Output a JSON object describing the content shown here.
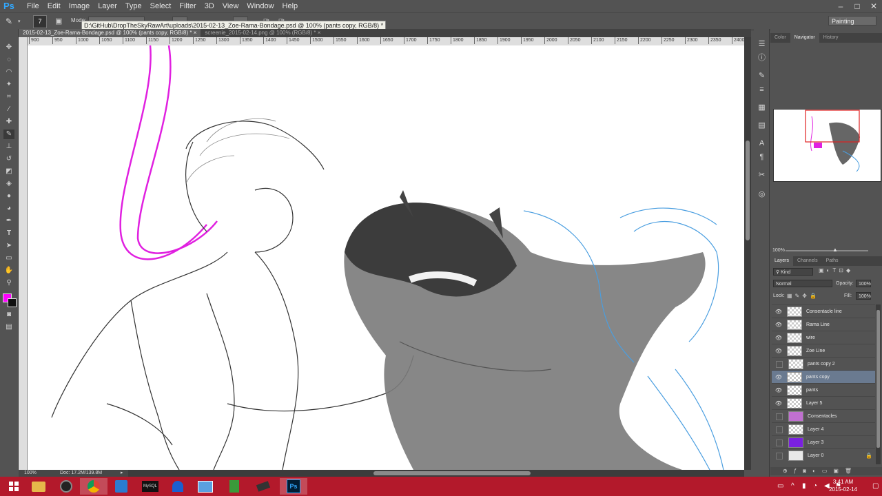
{
  "app": {
    "logo": "Ps"
  },
  "menu": [
    "File",
    "Edit",
    "Image",
    "Layer",
    "Type",
    "Select",
    "Filter",
    "3D",
    "View",
    "Window",
    "Help"
  ],
  "window_controls": [
    "–",
    "□",
    "✕"
  ],
  "options_bar": {
    "mode_label": "Mode:",
    "workspace": "Painting",
    "brush_size": "7",
    "tooltip": "D:\\GitHub\\DropTheSkyRawArt\\uploads\\2015-02-13_Zoe-Rama-Bondage.psd @ 100% (pants copy, RGB/8) *"
  },
  "tabs": [
    {
      "label": "2015-02-13_Zoe-Rama-Bondage.psd @ 100% (pants copy, RGB/8) *",
      "close": "×"
    },
    {
      "label": "screenie_2015-02-14.png @ 100% (RGB/8) *",
      "close": "×"
    }
  ],
  "ruler_h": [
    "900",
    "950",
    "1000",
    "1050",
    "1100",
    "1150",
    "1200",
    "1250",
    "1300",
    "1350",
    "1400",
    "1450",
    "1500",
    "1550",
    "1600",
    "1650",
    "1700",
    "1750",
    "1800",
    "1850",
    "1900",
    "1950",
    "2000",
    "2050",
    "2100",
    "2150",
    "2200",
    "2250",
    "2300",
    "2350",
    "2400"
  ],
  "status": {
    "zoom": "100%",
    "doc": "Doc: 17.2M/139.8M"
  },
  "panels": {
    "top_tabs": [
      "Color",
      "Navigator",
      "History"
    ],
    "nav_zoom": "100%",
    "layer_tabs": [
      "Layers",
      "Channels",
      "Paths"
    ],
    "kind": "Kind",
    "blend_mode": "Normal",
    "opacity_label": "Opacity:",
    "opacity": "100%",
    "lock_label": "Lock:",
    "fill_label": "Fill:",
    "fill": "100%"
  },
  "layers": [
    {
      "name": "Consentacle line",
      "visible": true,
      "selected": false,
      "locked": false
    },
    {
      "name": "Rama Line",
      "visible": true,
      "selected": false,
      "locked": false
    },
    {
      "name": "wire",
      "visible": true,
      "selected": false,
      "locked": false
    },
    {
      "name": "Zoe Line",
      "visible": true,
      "selected": false,
      "locked": false
    },
    {
      "name": "pants copy 2",
      "visible": false,
      "selected": false,
      "locked": false
    },
    {
      "name": "pants copy",
      "visible": true,
      "selected": true,
      "locked": false
    },
    {
      "name": "pants",
      "visible": true,
      "selected": false,
      "locked": false
    },
    {
      "name": "Layer 5",
      "visible": true,
      "selected": false,
      "locked": false
    },
    {
      "name": "Consentacles",
      "visible": false,
      "selected": false,
      "locked": false
    },
    {
      "name": "Layer 4",
      "visible": false,
      "selected": false,
      "locked": false
    },
    {
      "name": "Layer 3",
      "visible": false,
      "selected": false,
      "locked": false
    },
    {
      "name": "Layer 0",
      "visible": false,
      "selected": false,
      "locked": true
    }
  ],
  "taskbar": {
    "time": "3:41 AM",
    "date": "2015-02-14",
    "apps": [
      {
        "name": "file-explorer",
        "label": ""
      },
      {
        "name": "media-player",
        "label": ""
      },
      {
        "name": "chrome",
        "label": ""
      },
      {
        "name": "outlook",
        "label": ""
      },
      {
        "name": "terminal",
        "label": "MySQL"
      },
      {
        "name": "malwarebytes",
        "label": ""
      },
      {
        "name": "remote-desktop",
        "label": ""
      },
      {
        "name": "calculator",
        "label": ""
      },
      {
        "name": "sublime",
        "label": ""
      },
      {
        "name": "photoshop",
        "label": "Ps"
      }
    ]
  },
  "colors": {
    "foreground": "#ff00ff",
    "background": "#111111",
    "taskbar": "#b3192b",
    "accent": "#31a8ff"
  }
}
